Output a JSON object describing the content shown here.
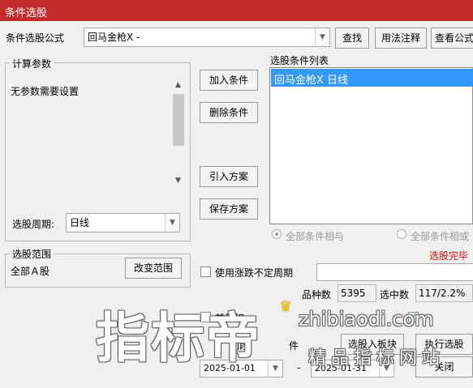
{
  "window": {
    "title": "条件选股",
    "close_glyph": "✕"
  },
  "formula": {
    "label": "条件选股公式",
    "value": "回马金枪X  -",
    "btn_search": "查找",
    "btn_usage": "用法注释",
    "btn_view": "查看公式"
  },
  "params": {
    "legend": "计算参数",
    "text": "无参数需要设置",
    "period_label": "选股周期:",
    "period_value": "日线"
  },
  "actions": {
    "add": "加入条件",
    "delete": "删除条件",
    "import": "引入方案",
    "save": "保存方案"
  },
  "conditions": {
    "label": "选股条件列表",
    "items": [
      "回马金枪X  日线"
    ]
  },
  "logic": {
    "all_and": "全部条件相与",
    "all_or": "全部条件相或"
  },
  "status": {
    "done": "选股完毕"
  },
  "range": {
    "legend": "选股范围",
    "value": "全部Ａ股",
    "change_btn": "改变范围"
  },
  "uncertain_period": {
    "label": "使用涨跌不定周期"
  },
  "stats": {
    "count_label": "品种数",
    "count_value": "5395",
    "selected_label": "选中数",
    "selected_value": "117/2.2%"
  },
  "lower": {
    "pre_restore_fragment": "前复权",
    "range_fragment": "间段",
    "cond_fragment": "件",
    "to_block_btn": "选股入板块",
    "run_btn": "执行选股",
    "close_btn": "关闭",
    "date_from": "2025-01-01",
    "date_sep": "-",
    "date_to": "2025-01-31"
  },
  "watermark": {
    "big": "指标帝",
    "url": "zhibiaodi.com",
    "tagline": "精品指标网站"
  },
  "colors": {
    "title_bg": "#c62b2b",
    "selection": "#3399ff",
    "status_red": "#e01010"
  }
}
